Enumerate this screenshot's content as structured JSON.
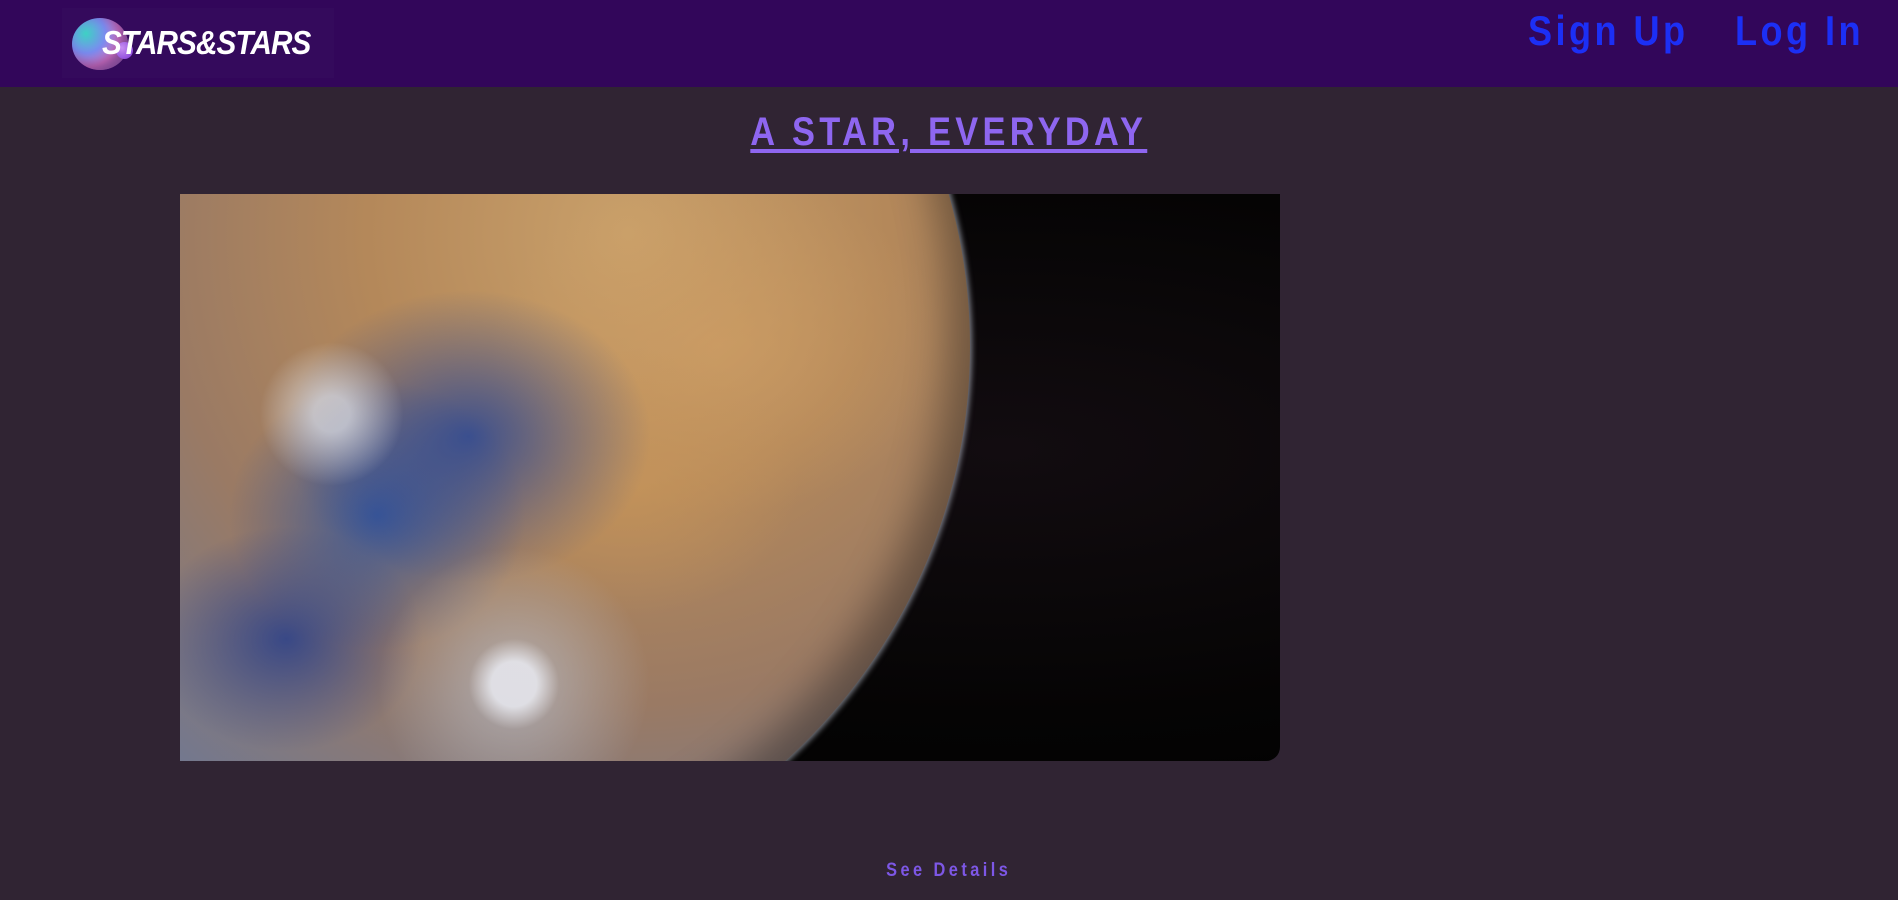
{
  "header": {
    "brand": "STARS&STARS",
    "logo_icon": "planet-orb-icon",
    "nav": {
      "signup_label": "Sign Up",
      "login_label": "Log In"
    }
  },
  "main": {
    "headline": "A STAR, EVERYDAY",
    "image_subject": "moon-photo",
    "details_label": "See Details"
  },
  "colors": {
    "background": "#302433",
    "header_bg": "#32065a",
    "nav_link": "#1c2ff5",
    "accent": "#8e66f0"
  }
}
